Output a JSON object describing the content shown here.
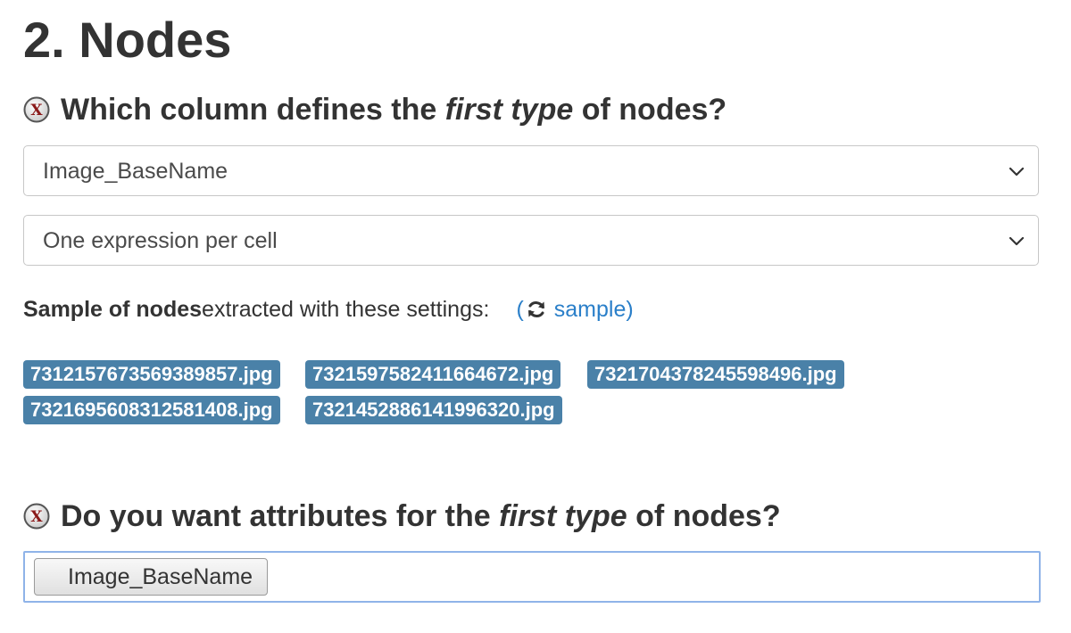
{
  "section": {
    "title": "2. Nodes"
  },
  "question1": {
    "text_before": "Which column defines the ",
    "text_em": "first type",
    "text_after": " of nodes?",
    "icon": "remove-x-icon"
  },
  "column_select": {
    "value": "Image_BaseName"
  },
  "mode_select": {
    "value": "One expression per cell"
  },
  "sample": {
    "bold_label": "Sample of nodes",
    "label_rest": " extracted with these settings:",
    "link_open": "(",
    "link_text": "sample)",
    "icon": "refresh-icon"
  },
  "sample_nodes": [
    "7312157673569389857.jpg",
    "7321597582411664672.jpg",
    "7321704378245598496.jpg",
    "7321695608312581408.jpg",
    "7321452886141996320.jpg"
  ],
  "question2": {
    "text_before": "Do you want attributes for the ",
    "text_em": "first type",
    "text_after": " of nodes?",
    "icon": "remove-x-icon"
  },
  "attributes": {
    "selected": [
      "Image_BaseName"
    ]
  },
  "colors": {
    "chip_background": "#4a81a8",
    "link": "#2a7fc9",
    "focus_border": "#8fb3e8"
  }
}
